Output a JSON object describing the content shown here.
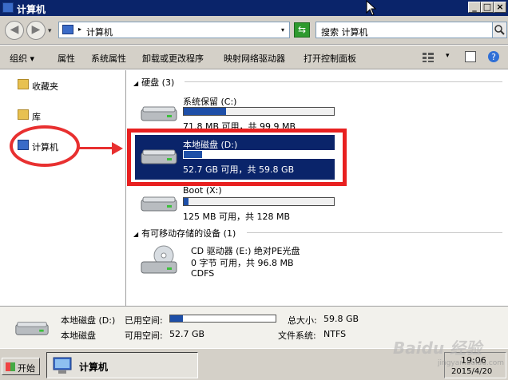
{
  "window": {
    "title": "计算机",
    "min_label": "_",
    "max_label": "□",
    "close_label": "×"
  },
  "addressbar": {
    "back_label": "◀",
    "forward_label": "▶",
    "path": "计算机",
    "separator": "▸",
    "dropdown": "▾",
    "refresh_label": "⇆",
    "search_placeholder": "搜索 计算机"
  },
  "toolbar": {
    "organize": "组织 ▾",
    "properties": "属性",
    "system_properties": "系统属性",
    "uninstall": "卸载或更改程序",
    "map_drive": "映射网络驱动器",
    "control_panel": "打开控制面板",
    "view_dropdown": "▾"
  },
  "sidebar": {
    "items": [
      {
        "label": "收藏夹",
        "icon": "folder-icon"
      },
      {
        "label": "库",
        "icon": "folder-icon"
      },
      {
        "label": "计算机",
        "icon": "computer-icon"
      }
    ]
  },
  "main": {
    "hard_disks_header": "硬盘 (3)",
    "removable_header": "有可移动存储的设备 (1)",
    "group_toggle": "◢",
    "drives": [
      {
        "name": "系统保留 (C:)",
        "info": "71.8 MB 可用，共 99.9 MB",
        "used_fraction": 0.28
      },
      {
        "name": "本地磁盘 (D:)",
        "info": "52.7 GB 可用，共 59.8 GB",
        "used_fraction": 0.12
      },
      {
        "name": "Boot (X:)",
        "info": "125 MB 可用，共 128 MB",
        "used_fraction": 0.03
      }
    ],
    "cd_drive": {
      "name": "CD 驱动器 (E:) 绝对PE光盘",
      "info": "0 字节 可用，共 96.8 MB",
      "fs": "CDFS"
    }
  },
  "details": {
    "name": "本地磁盘 (D:)",
    "type": "本地磁盘",
    "used_label": "已用空间:",
    "free_label": "可用空间:",
    "free_value": "52.7 GB",
    "total_label": "总大小:",
    "total_value": "59.8 GB",
    "fs_label": "文件系统:",
    "fs_value": "NTFS",
    "used_fraction": 0.12
  },
  "taskbar": {
    "start_label": "开始",
    "task_label": "计算机",
    "time": "19:06",
    "date": "2015/4/20"
  },
  "watermark": {
    "text": "Baidu 经验",
    "url": "jingyan.baidu.com"
  },
  "colors": {
    "title_blue": "#0a246a",
    "selection": "#0a246a",
    "annotation_red": "#e83030",
    "bar_fill": "#1e4fa8"
  }
}
